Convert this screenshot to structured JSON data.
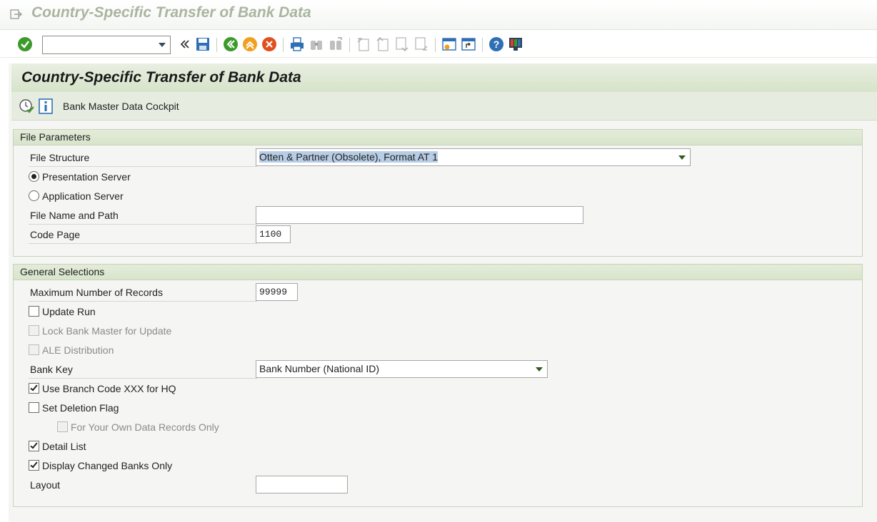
{
  "window": {
    "title": "Country-Specific Transfer of Bank Data"
  },
  "toolbar": {
    "command_field_value": "",
    "icons": [
      "enter-icon",
      "command-field",
      "back-double-arrow-icon",
      "save-icon",
      "back-icon",
      "exit-icon",
      "cancel-icon",
      "print-icon",
      "find-icon",
      "find-next-icon",
      "first-page-icon",
      "previous-page-icon",
      "next-page-icon",
      "last-page-icon",
      "create-session-icon",
      "shortcut-icon",
      "help-icon",
      "customize-layout-icon"
    ]
  },
  "page": {
    "title": "Country-Specific Transfer of Bank Data",
    "app_toolbar": {
      "execute_icon": "execute-icon",
      "info_icon": "info-icon",
      "cockpit_label": "Bank Master Data Cockpit"
    }
  },
  "file_parameters": {
    "title": "File Parameters",
    "file_structure_label": "File Structure",
    "file_structure_value": "Otten & Partner (Obsolete), Format AT 1",
    "presentation_server_label": "Presentation Server",
    "presentation_server_selected": true,
    "application_server_label": "Application Server",
    "application_server_selected": false,
    "file_name_label": "File Name and Path",
    "file_name_value": "",
    "code_page_label": "Code Page",
    "code_page_value": "1100"
  },
  "general_selections": {
    "title": "General Selections",
    "max_records_label": "Maximum Number of Records",
    "max_records_value": "99999",
    "update_run_label": "Update Run",
    "update_run_checked": false,
    "lock_bank_master_label": "Lock Bank Master for Update",
    "lock_bank_master_checked": false,
    "ale_distribution_label": "ALE Distribution",
    "ale_distribution_checked": false,
    "bank_key_label": "Bank Key",
    "bank_key_value": "Bank Number (National ID)",
    "branch_code_label": "Use Branch Code XXX for HQ",
    "branch_code_checked": true,
    "deletion_flag_label": "Set Deletion Flag",
    "deletion_flag_checked": false,
    "own_records_label": "For Your Own Data Records Only",
    "own_records_checked": false,
    "detail_list_label": "Detail List",
    "detail_list_checked": true,
    "changed_banks_label": "Display Changed Banks Only",
    "changed_banks_checked": true,
    "layout_label": "Layout",
    "layout_value": ""
  },
  "colors": {
    "header_green": "#d6e3c9",
    "title_grey": "#aab5a0",
    "selection_highlight": "#b7cde6"
  }
}
